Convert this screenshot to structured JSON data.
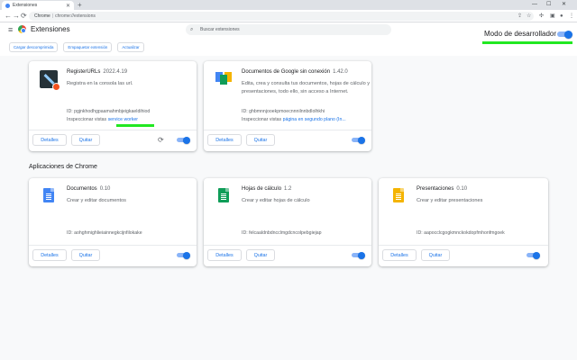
{
  "browser": {
    "tab_title": "Extensiones",
    "new_tab": "+",
    "omnibox_site": "Chrome",
    "omnibox_url": "chrome://extensions"
  },
  "header": {
    "title": "Extensiones",
    "search_placeholder": "Buscar extensiones",
    "dev_mode_label": "Modo de desarrollador",
    "dev_mode_on": true,
    "actions": [
      "Cargar descomprimida",
      "Empaquetar extensión",
      "Actualizar"
    ]
  },
  "extensions": [
    {
      "name": "RegisterURLs",
      "version": "2022.4.19",
      "description": "Registra en la consola las url.",
      "id": "ID: pgjnkhodhgpaamahmbjeigkaeldihiod",
      "views_label": "Inspeccionar vistas",
      "views_link": "service worker",
      "details": "Detalles",
      "remove": "Quitar",
      "enabled": true
    },
    {
      "name": "Documentos de Google sin conexión",
      "version": "1.42.0",
      "description": "Edita, crea y consulta tus documentos, hojas de cálculo y presentaciones, todo ello, sin acceso a Internet.",
      "id": "ID: ghbmnnjooekpmoecnnnilnnbdlolhkhi",
      "views_label": "Inspeccionar vistas",
      "views_link": "página en segundo plano (In...",
      "details": "Detalles",
      "remove": "Quitar",
      "enabled": true
    }
  ],
  "apps_section_title": "Aplicaciones de Chrome",
  "apps": [
    {
      "name": "Documentos",
      "version": "0.10",
      "description": "Crear y editar documentos",
      "id": "ID: aohghmighlieiainnegkcijnfilokake",
      "details": "Detalles",
      "remove": "Quitar",
      "enabled": true,
      "color": "#4285f4"
    },
    {
      "name": "Hojas de cálculo",
      "version": "1.2",
      "description": "Crear y editar hojas de cálculo",
      "id": "ID: felcaaldnbdncclmgdcncolpebgiejap",
      "details": "Detalles",
      "remove": "Quitar",
      "enabled": true,
      "color": "#0f9d58"
    },
    {
      "name": "Presentaciones",
      "version": "0.10",
      "description": "Crear y editar presentaciones",
      "id": "ID: aapocclcgogkmnckokdopfmhonfmgoek",
      "details": "Detalles",
      "remove": "Quitar",
      "enabled": true,
      "color": "#f4b400"
    }
  ],
  "colors": {
    "accent": "#1a73e8",
    "highlight": "#22e822"
  }
}
